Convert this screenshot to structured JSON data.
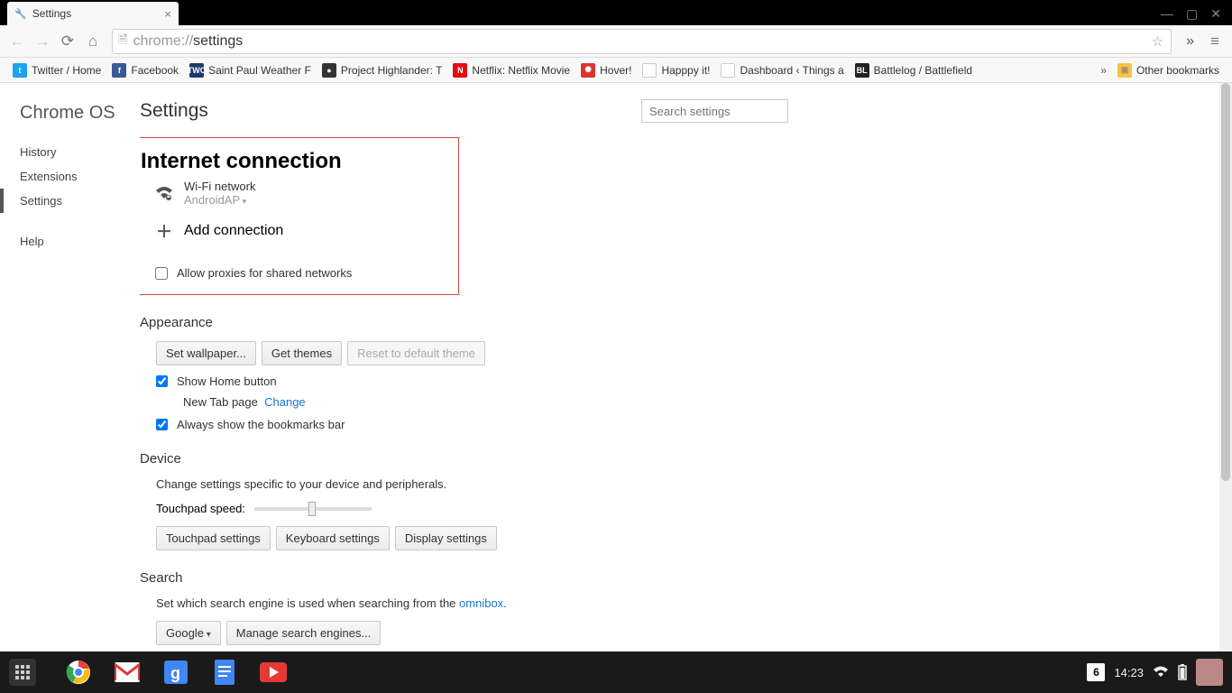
{
  "tab": {
    "title": "Settings"
  },
  "omnibox": {
    "proto": "chrome://",
    "path": "settings"
  },
  "bookmarks": [
    {
      "label": "Twitter / Home",
      "bg": "#1da1f2",
      "txt": "t"
    },
    {
      "label": "Facebook",
      "bg": "#3b5998",
      "txt": "f"
    },
    {
      "label": "Saint Paul Weather F",
      "bg": "#1b3a6b",
      "txt": "TWC"
    },
    {
      "label": "Project Highlander: T",
      "bg": "#333",
      "txt": "●"
    },
    {
      "label": "Netflix: Netflix Movie",
      "bg": "#e50914",
      "txt": "N"
    },
    {
      "label": "Hover!",
      "bg": "#d33",
      "txt": "✺"
    },
    {
      "label": "Happpy it!",
      "bg": "#fff",
      "txt": ""
    },
    {
      "label": "Dashboard ‹ Things a",
      "bg": "#fff",
      "txt": ""
    },
    {
      "label": "Battlelog / Battlefield",
      "bg": "#222",
      "txt": "BL"
    }
  ],
  "other_bookmarks": "Other bookmarks",
  "brand": "Chrome OS",
  "nav": {
    "history": "History",
    "extensions": "Extensions",
    "settings": "Settings",
    "help": "Help"
  },
  "page_title": "Settings",
  "search_placeholder": "Search settings",
  "internet": {
    "heading": "Internet connection",
    "wifi_title": "Wi-Fi network",
    "wifi_name": "AndroidAP",
    "add": "Add connection",
    "proxy_label": "Allow proxies for shared networks"
  },
  "appearance": {
    "heading": "Appearance",
    "set_wallpaper": "Set wallpaper...",
    "get_themes": "Get themes",
    "reset_theme": "Reset to default theme",
    "show_home": "Show Home button",
    "new_tab": "New Tab page",
    "change": "Change",
    "show_bm": "Always show the bookmarks bar"
  },
  "device": {
    "heading": "Device",
    "desc": "Change settings specific to your device and peripherals.",
    "touchpad_speed": "Touchpad speed:",
    "touchpad": "Touchpad settings",
    "keyboard": "Keyboard settings",
    "display": "Display settings"
  },
  "search": {
    "heading": "Search",
    "desc_a": "Set which search engine is used when searching from the ",
    "omni_link": "omnibox",
    "engine": "Google",
    "manage": "Manage search engines..."
  },
  "shelf": {
    "notif": "6",
    "time": "14:23"
  }
}
